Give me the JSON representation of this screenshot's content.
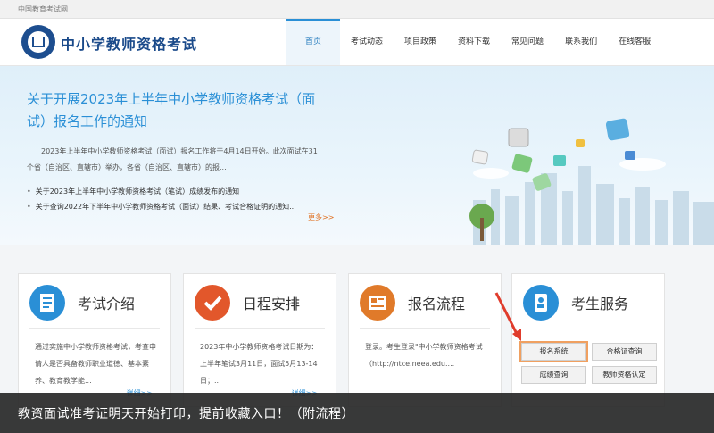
{
  "topbar": {
    "site_name": "中国教育考试网"
  },
  "header": {
    "title": "中小学教师资格考试"
  },
  "nav": [
    "首页",
    "考试动态",
    "项目政策",
    "资料下载",
    "常见问题",
    "联系我们",
    "在线客服"
  ],
  "banner": {
    "title": "关于开展2023年上半年中小学教师资格考试（面试）报名工作的通知",
    "body": "2023年上半年中小学教师资格考试（面试）报名工作将于4月14日开始。此次面试在31个省（自治区、直辖市）举办，各省（自治区、直辖市）的报...",
    "news": [
      "关于2023年上半年中小学教师资格考试（笔试）成绩发布的通知",
      "关于查询2022年下半年中小学教师资格考试（面试）结果、考试合格证明的通知..."
    ],
    "more": "更多>>"
  },
  "cards": [
    {
      "title": "考试介绍",
      "desc": "通过实施中小学教师资格考试，考查申请人是否具备教师职业道德、基本素养、教育教学能...",
      "more": "详细>>",
      "color": "#2a8fd6"
    },
    {
      "title": "日程安排",
      "desc": "2023年中小学教师资格考试日期为：上半年笔试3月11日，面试5月13-14日；...",
      "more": "详细>>",
      "color": "#e2572b"
    },
    {
      "title": "报名流程",
      "desc": "登录。考生登录\"中小学教师资格考试（http://ntce.neea.edu....",
      "more": "",
      "color": "#e07a2a"
    },
    {
      "title": "考生服务",
      "color": "#2a8fd6",
      "buttons": [
        "报名系统",
        "合格证查询",
        "成绩查询",
        "教师资格认定"
      ]
    }
  ],
  "caption": "教资面试准考证明天开始打印，提前收藏入口！（附流程）"
}
